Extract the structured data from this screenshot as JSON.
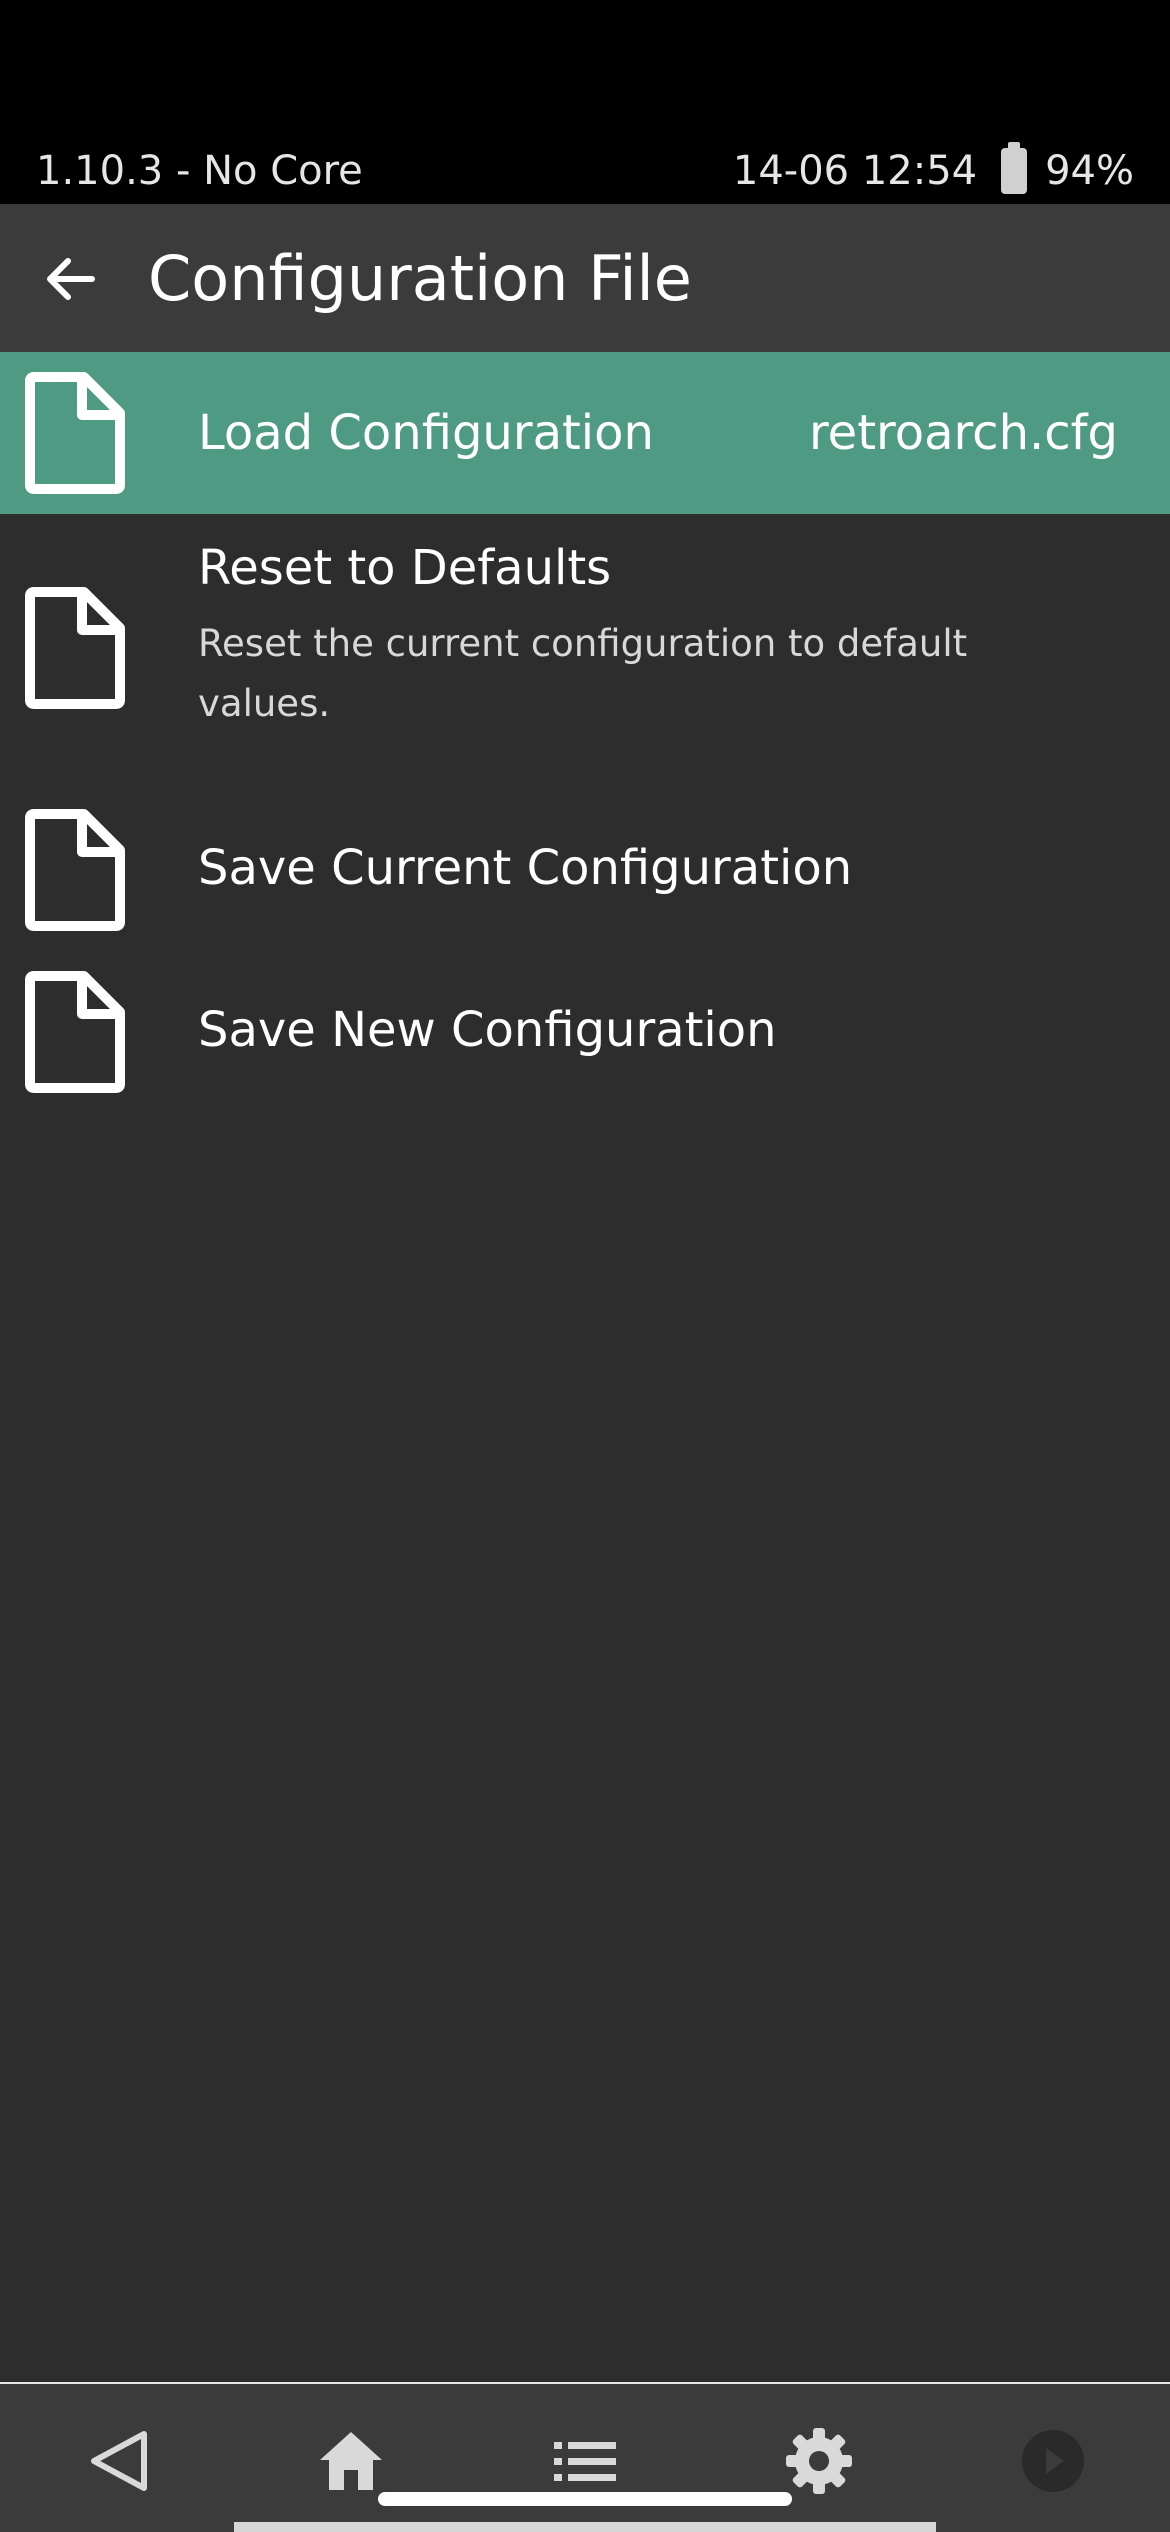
{
  "status_bar": {
    "left_text": "1.10.3 - No Core",
    "datetime": "14-06 12:54",
    "battery_percent": "94%",
    "battery_icon": "battery-icon"
  },
  "header": {
    "back_icon": "arrow-left-icon",
    "title": "Configuration File"
  },
  "colors": {
    "selected_row": "#4e9a82",
    "background": "#2d2d2d",
    "header": "#3b3b3b",
    "status_bar": "#000000"
  },
  "menu": {
    "items": [
      {
        "label": "Load Configuration",
        "value": "retroarch.cfg",
        "icon": "file-icon",
        "selected": true
      },
      {
        "label": "Reset to Defaults",
        "sublabel": "Reset the current configuration to default values.",
        "icon": "file-icon",
        "selected": false
      },
      {
        "label": "Save Current Configuration",
        "icon": "file-icon",
        "selected": false
      },
      {
        "label": "Save New Configuration",
        "icon": "file-icon",
        "selected": false
      }
    ]
  },
  "navbar": {
    "items": [
      {
        "icon": "back-triangle-icon"
      },
      {
        "icon": "home-icon"
      },
      {
        "icon": "list-icon"
      },
      {
        "icon": "gear-icon"
      },
      {
        "icon": "play-circle-icon"
      }
    ]
  }
}
